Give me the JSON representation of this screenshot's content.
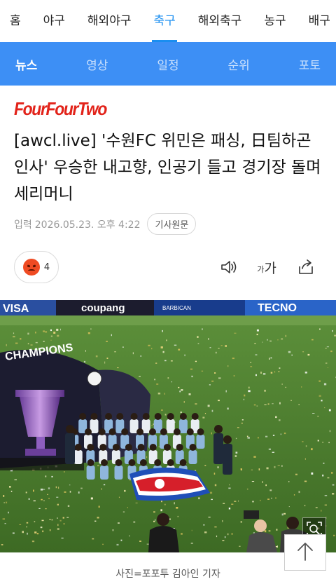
{
  "sport_nav": {
    "items": [
      {
        "label": "홈"
      },
      {
        "label": "야구"
      },
      {
        "label": "해외야구"
      },
      {
        "label": "축구"
      },
      {
        "label": "해외축구"
      },
      {
        "label": "농구"
      },
      {
        "label": "배구"
      }
    ],
    "active_index": 3,
    "active_color": "#1a8ef0"
  },
  "sub_nav": {
    "items": [
      {
        "label": "뉴스"
      },
      {
        "label": "영상"
      },
      {
        "label": "일정"
      },
      {
        "label": "순위"
      },
      {
        "label": "포토"
      }
    ],
    "active_index": 0,
    "background": "#3d8ff5"
  },
  "article": {
    "publisher_logo_text": "FourFourTwo",
    "title": "[awcl.live] '수원FC 위민은 패싱, 日팀하곤 인사' 우승한 내고향, 인공기 들고 경기장 돌며 세리머니",
    "date_label": "입력",
    "date": "2026.05.23. 오후 4:22",
    "original_button": "기사원문",
    "reaction": {
      "icon": "angry-face-icon",
      "count": "4"
    },
    "tools": {
      "speaker_icon": "speaker-icon",
      "font_small": "가",
      "font_big": "가",
      "share_icon": "share-icon"
    },
    "photo": {
      "ad_boards": [
        "VISA",
        "coupang",
        "BARBICAN",
        "TECNO"
      ],
      "trophy_banner": "CHAMPIONS"
    },
    "caption": "사진=포포투 김아인 기자"
  },
  "floating": {
    "zoom_icon": "zoom-icon",
    "top_icon": "arrow-up-icon"
  }
}
